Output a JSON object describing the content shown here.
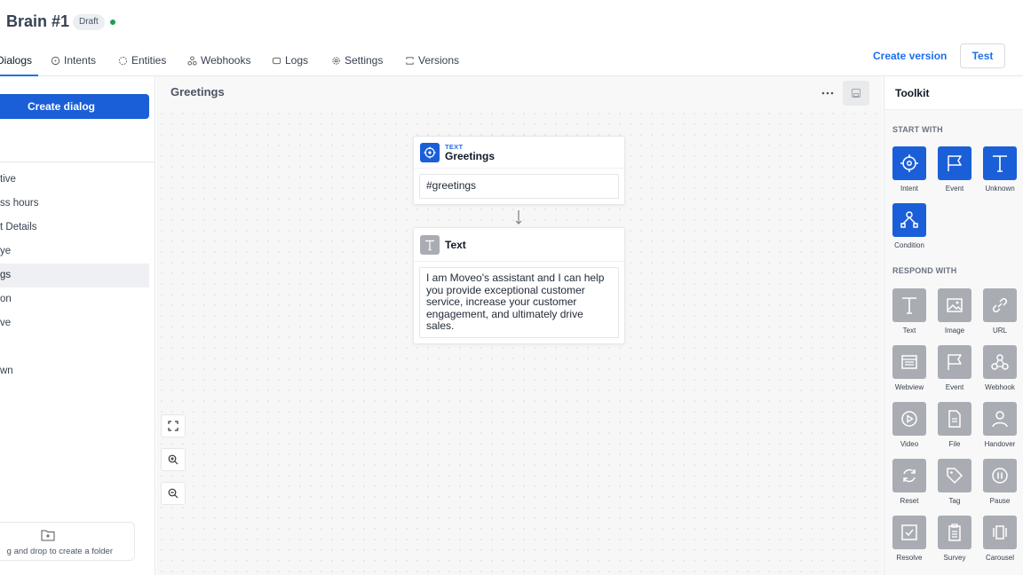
{
  "header": {
    "title": "Brain #1",
    "badge": "Draft"
  },
  "tabs": [
    {
      "label": "Dialogs",
      "icon": "dialogs-icon"
    },
    {
      "label": "Intents",
      "icon": "target-icon"
    },
    {
      "label": "Entities",
      "icon": "entities-icon"
    },
    {
      "label": "Webhooks",
      "icon": "webhook-icon"
    },
    {
      "label": "Logs",
      "icon": "logs-icon"
    },
    {
      "label": "Settings",
      "icon": "gear-icon"
    },
    {
      "label": "Versions",
      "icon": "versions-icon"
    }
  ],
  "actions": {
    "create_version": "Create version",
    "test": "Test"
  },
  "sidebar": {
    "create_dialog": "Create dialog",
    "items": [
      {
        "label": "tive"
      },
      {
        "label": "ss hours"
      },
      {
        "label": "t Details"
      },
      {
        "label": "ye"
      },
      {
        "label": "gs",
        "selected": true
      },
      {
        "label": "on"
      },
      {
        "label": "ve"
      },
      {
        "label": ""
      },
      {
        "label": "wn"
      }
    ],
    "drop_text": "g and drop to create a folder"
  },
  "canvas": {
    "title": "Greetings",
    "trigger_node": {
      "type_label": "TEXT",
      "title": "Greetings",
      "value": "#greetings"
    },
    "response_node": {
      "title": "Text",
      "text": "I am Moveo's assistant and I can help you provide exceptional customer service, increase your customer engagement, and ultimately drive sales."
    }
  },
  "toolkit": {
    "title": "Toolkit",
    "start_label": "START WITH",
    "respond_label": "RESPOND WITH",
    "start_with": [
      {
        "label": "Intent",
        "icon": "target-icon"
      },
      {
        "label": "Event",
        "icon": "flag-icon"
      },
      {
        "label": "Unknown",
        "icon": "text-t-icon"
      },
      {
        "label": "Condition",
        "icon": "condition-icon"
      }
    ],
    "respond_with": [
      {
        "label": "Text",
        "icon": "text-t-icon"
      },
      {
        "label": "Image",
        "icon": "image-icon"
      },
      {
        "label": "URL",
        "icon": "link-icon"
      },
      {
        "label": "Webview",
        "icon": "webview-icon"
      },
      {
        "label": "Event",
        "icon": "flag-icon"
      },
      {
        "label": "Webhook",
        "icon": "webhook-icon"
      },
      {
        "label": "Video",
        "icon": "play-icon"
      },
      {
        "label": "File",
        "icon": "file-icon"
      },
      {
        "label": "Handover",
        "icon": "person-icon"
      },
      {
        "label": "Reset",
        "icon": "reset-icon"
      },
      {
        "label": "Tag",
        "icon": "tag-icon"
      },
      {
        "label": "Pause",
        "icon": "pause-icon"
      },
      {
        "label": "Resolve",
        "icon": "checkbox-icon"
      },
      {
        "label": "Survey",
        "icon": "survey-icon"
      },
      {
        "label": "Carousel",
        "icon": "carousel-icon"
      }
    ]
  },
  "colors": {
    "accent": "#1a5fd8",
    "status_green": "#16a34a",
    "tool_gray": "#a9adb3"
  }
}
